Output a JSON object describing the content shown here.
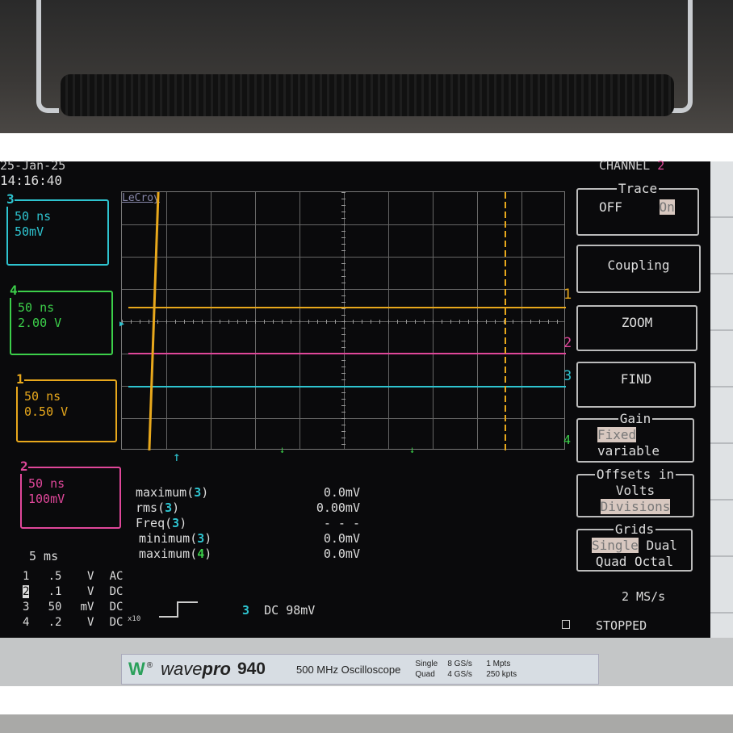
{
  "header": {
    "date": "25-Jan-25",
    "time": "14:16:40",
    "menu_title": "CHANNEL",
    "menu_channel": "2"
  },
  "brand_grid": "LeCroy",
  "channels": [
    {
      "id": "3",
      "timebase": "50 ns",
      "scale": "50mV",
      "color": "#2ec4d0"
    },
    {
      "id": "4",
      "timebase": "50 ns",
      "scale": "2.00 V",
      "color": "#3ccf4a"
    },
    {
      "id": "1",
      "timebase": "50 ns",
      "scale": "0.50 V",
      "color": "#e8a81c"
    },
    {
      "id": "2",
      "timebase": "50 ns",
      "scale": "100mV",
      "color": "#e0479a"
    }
  ],
  "trace_markers": [
    "1",
    "2",
    "3",
    "4"
  ],
  "measurements": [
    {
      "label": "maximum(",
      "ch": "3",
      "value": "0.0mV",
      "color": "#2ec4d0"
    },
    {
      "label": "rms(",
      "ch": "3",
      "value": "0.00mV",
      "color": "#2ec4d0"
    },
    {
      "label": "Freq(",
      "ch": "3",
      "value": "- - -",
      "color": "#2ec4d0"
    },
    {
      "label": "minimum(",
      "ch": "3",
      "value": "0.0mV",
      "color": "#2ec4d0"
    },
    {
      "label": "maximum(",
      "ch": "4",
      "value": "0.0mV",
      "color": "#3ccf4a"
    }
  ],
  "timebase": "5 ms",
  "channel_settings": [
    {
      "ch": "1",
      "scale": ".5",
      "unit": "V",
      "coupling": "AC"
    },
    {
      "ch": "2",
      "scale": ".1",
      "unit": "V",
      "coupling": "DC"
    },
    {
      "ch": "3",
      "scale": "50",
      "unit": "mV",
      "coupling": "DC"
    },
    {
      "ch": "4",
      "scale": ".2",
      "unit": "V",
      "coupling": "DC"
    }
  ],
  "probe_mark": "x10",
  "trigger": {
    "channel": "3",
    "coupling": "DC",
    "level": "98mV"
  },
  "menu": {
    "trace": {
      "title": "Trace",
      "off": "OFF",
      "on": "On"
    },
    "coupling": "Coupling",
    "zoom": "ZOOM",
    "find": "FIND",
    "gain": {
      "title": "Gain",
      "fixed": "Fixed",
      "variable": "variable"
    },
    "offsets": {
      "title": "Offsets in",
      "volts": "Volts",
      "divisions": "Divisions"
    },
    "grids": {
      "title": "Grids",
      "single": "Single",
      "dual": "Dual",
      "quad": "Quad",
      "octal": "Octal"
    }
  },
  "sample_rate": "2 MS/s",
  "status": "STOPPED",
  "label": {
    "logo": "W",
    "model_prefix": "wave",
    "model_bold": "pro",
    "model_num": "940",
    "desc": "500 MHz Oscilloscope",
    "spec": [
      [
        "Single",
        "8 GS/s",
        "1 Mpts"
      ],
      [
        "Quad",
        "4 GS/s",
        "250 kpts"
      ]
    ]
  }
}
